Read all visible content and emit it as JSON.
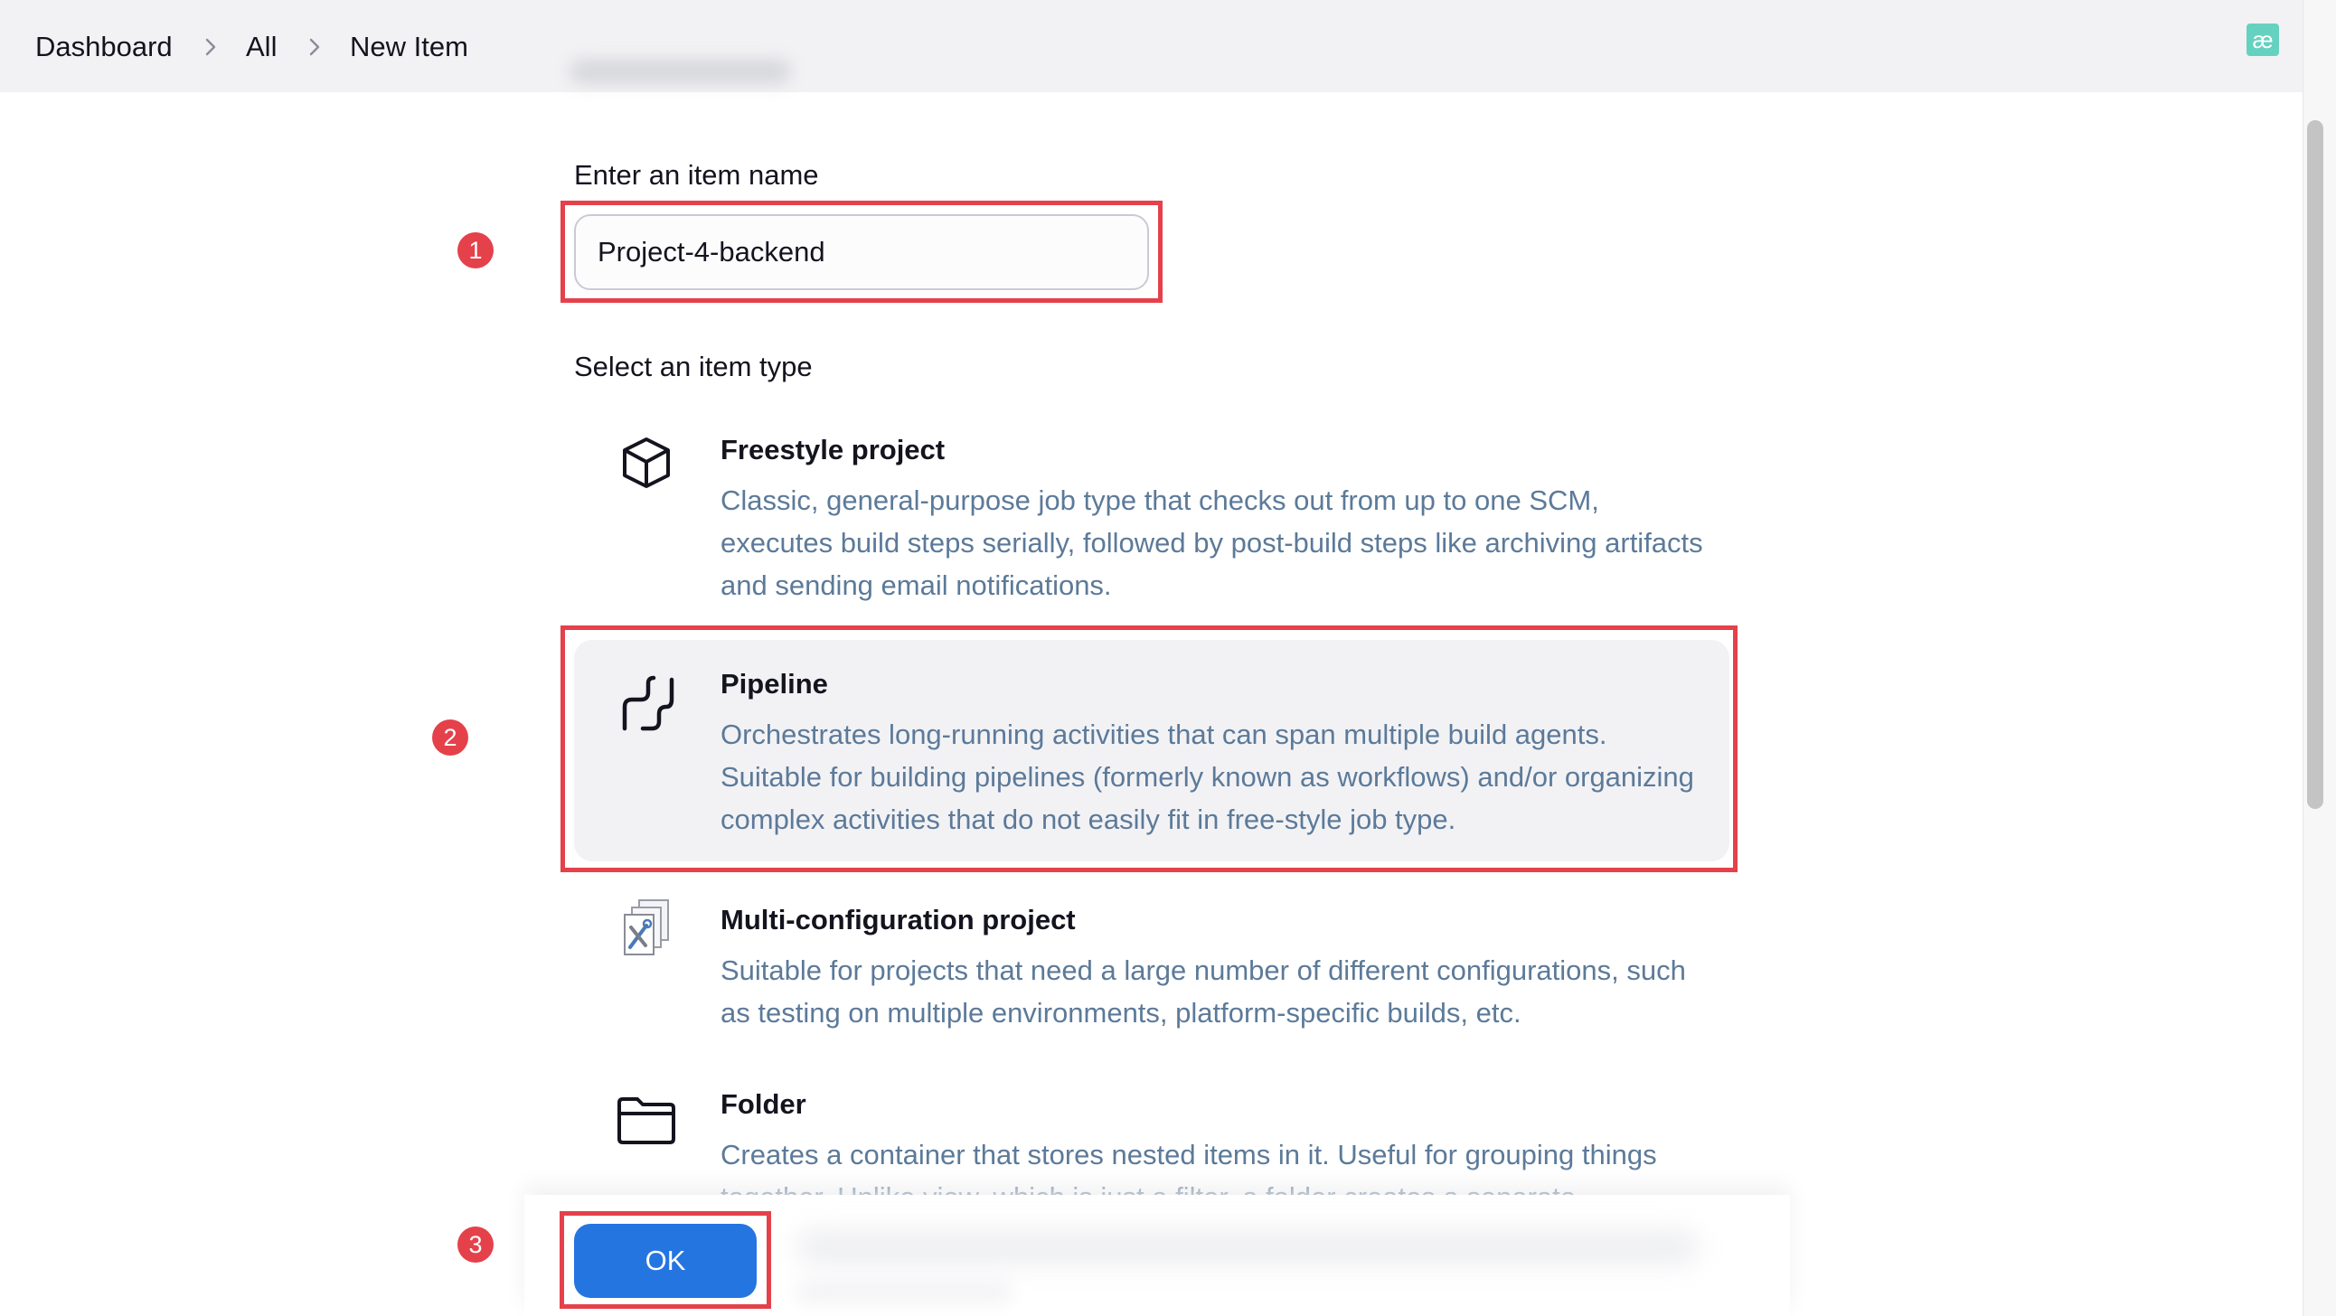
{
  "breadcrumb": {
    "items": [
      {
        "label": "Dashboard"
      },
      {
        "label": "All"
      },
      {
        "label": "New Item"
      }
    ]
  },
  "header": {
    "badge_text": "æ",
    "badge_color": "#65d2c0"
  },
  "form": {
    "name_label": "Enter an item name",
    "name_value": "Project-4-backend",
    "type_label": "Select an item type"
  },
  "item_types": [
    {
      "title": "Freestyle project",
      "description": "Classic, general-purpose job type that checks out from up to one SCM, executes build steps serially, followed by post-build steps like archiving artifacts and sending email notifications.",
      "icon": "package-icon",
      "selected": false
    },
    {
      "title": "Pipeline",
      "description": "Orchestrates long-running activities that can span multiple build agents. Suitable for building pipelines (formerly known as workflows) and/or organizing complex activities that do not easily fit in free-style job type.",
      "icon": "pipeline-icon",
      "selected": true
    },
    {
      "title": "Multi-configuration project",
      "description": "Suitable for projects that need a large number of different configurations, such as testing on multiple environments, platform-specific builds, etc.",
      "icon": "multi-config-icon",
      "selected": false
    },
    {
      "title": "Folder",
      "description": "Creates a container that stores nested items in it. Useful for grouping things together. Unlike view, which is just a filter, a folder creates a separate",
      "icon": "folder-icon",
      "selected": false
    }
  ],
  "footer": {
    "ok_label": "OK"
  },
  "annotations": {
    "color": "#e5414b",
    "badges": [
      "1",
      "2",
      "3"
    ]
  },
  "colors": {
    "primary_button": "#2575e0",
    "description_text": "#5c7a99",
    "header_bg": "#f2f2f4"
  }
}
